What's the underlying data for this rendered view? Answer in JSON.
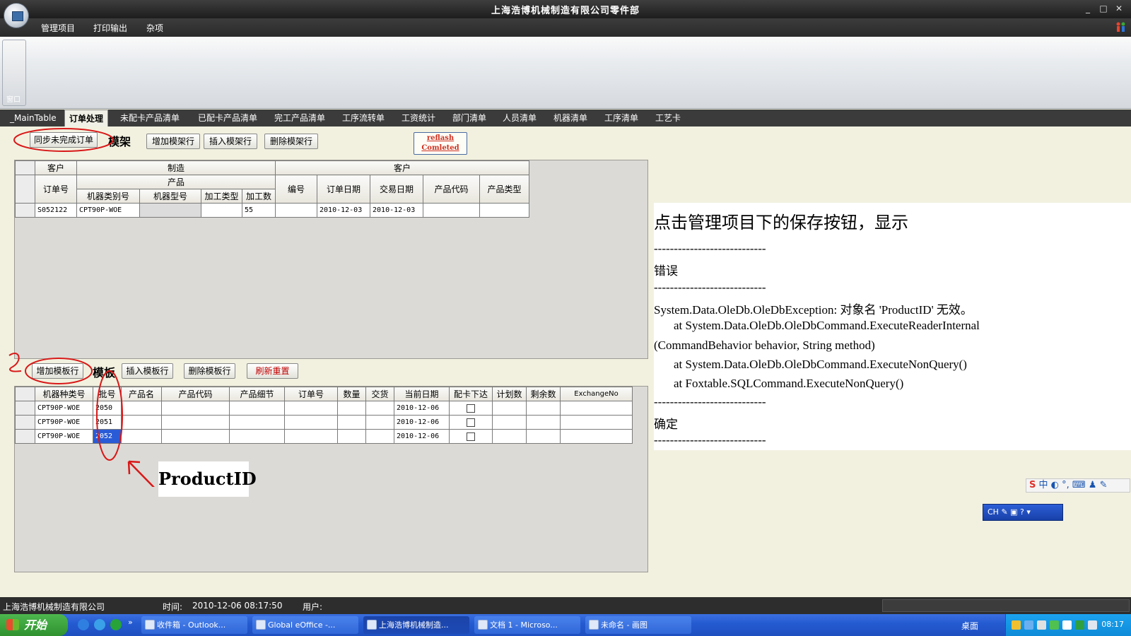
{
  "window": {
    "title": "上海浩博机械制造有限公司零件部",
    "controls": [
      "_",
      "□",
      "✕"
    ]
  },
  "menu": [
    "管理项目",
    "打印输出",
    "杂项"
  ],
  "ribbon": {
    "group_label": "窗口"
  },
  "tabs": [
    {
      "label": "_MainTable",
      "active": false
    },
    {
      "label": "订单处理",
      "active": true
    },
    {
      "label": "未配卡产品清单",
      "active": false
    },
    {
      "label": "已配卡产品清单",
      "active": false
    },
    {
      "label": "完工产品清单",
      "active": false
    },
    {
      "label": "工序流转单",
      "active": false
    },
    {
      "label": "工资统计",
      "active": false
    },
    {
      "label": "部门清单",
      "active": false
    },
    {
      "label": "人员清单",
      "active": false
    },
    {
      "label": "机器清单",
      "active": false
    },
    {
      "label": "工序清单",
      "active": false
    },
    {
      "label": "工艺卡",
      "active": false
    }
  ],
  "rack": {
    "sync_button": "同步未完成订单",
    "section_label": "模架",
    "add_row": "增加模架行",
    "insert_row": "插入模架行",
    "delete_row": "删除模架行",
    "reflash_line1": "reflash",
    "reflash_line2": "Comleted",
    "header_groups": {
      "customer_left": "客户",
      "manufacture": "制造",
      "customer_right": "客户",
      "product": "产品"
    },
    "columns": {
      "order_no": "订单号",
      "machine_category": "机器类别号",
      "machine_model": "机器型号",
      "process_type": "加工类型",
      "process_count": "加工数",
      "number": "编号",
      "order_date": "订单日期",
      "delivery_date": "交易日期",
      "product_code": "产品代码",
      "product_type": "产品类型"
    },
    "rows": [
      {
        "order_no": "S052122",
        "machine_category": "CPT90P-WOE",
        "machine_model": "",
        "process_type": "",
        "process_count": "55",
        "number": "",
        "order_date": "2010-12-03",
        "delivery_date": "2010-12-03",
        "product_code": "",
        "product_type": ""
      }
    ]
  },
  "template": {
    "section_label": "模板",
    "add_row": "增加模板行",
    "insert_row": "插入模板行",
    "delete_row": "删除模板行",
    "refresh_reset": "刷新重置",
    "columns": [
      "机器种类号",
      "批号",
      "产品名",
      "产品代码",
      "产品细节",
      "订单号",
      "数量",
      "交货",
      "当前日期",
      "配卡下达",
      "计划数",
      "剩余数",
      "ExchangeNo"
    ],
    "rows": [
      {
        "machine": "CPT90P-WOE",
        "batch": "2050",
        "date": "2010-12-06",
        "checked": false,
        "selected": false
      },
      {
        "machine": "CPT90P-WOE",
        "batch": "2051",
        "date": "2010-12-06",
        "checked": false,
        "selected": false
      },
      {
        "machine": "CPT90P-WOE",
        "batch": "2052",
        "date": "2010-12-06",
        "checked": false,
        "selected": true
      }
    ]
  },
  "annotations": {
    "mark1": "1",
    "mark2": "2",
    "productid_label": "ProductID"
  },
  "error_message": {
    "heading": "点击管理项目下的保存按钮，显示",
    "separator": "----------------------------",
    "title": "错误",
    "line1": "System.Data.OleDb.OleDbException:  对象名  'ProductID'  无效。",
    "line2": "at System.Data.OleDb.OleDbCommand.ExecuteReaderInternal",
    "line3": "(CommandBehavior behavior, String method)",
    "line4": "at System.Data.OleDb.OleDbCommand.ExecuteNonQuery()",
    "line5": "at Foxtable.SQLCommand.ExecuteNonQuery()",
    "ok": "确定"
  },
  "ime": {
    "toolbar": "中 ◐ °, ⌨ ♟ ✎",
    "langbar": "CH"
  },
  "statusbar": {
    "company": "上海浩博机械制造有限公司",
    "time_label": "时间:",
    "time_value": "2010-12-06 08:17:50",
    "user_label": "用户:"
  },
  "taskbar": {
    "start": "开始",
    "tasks": [
      {
        "label": "收件箱 - Outlook...",
        "active": false
      },
      {
        "label": "Global eOffice -...",
        "active": false
      },
      {
        "label": "上海浩博机械制造...",
        "active": true
      },
      {
        "label": "文档 1 - Microso...",
        "active": false
      },
      {
        "label": "未命名 - 画图",
        "active": false
      }
    ],
    "desktop": "桌面",
    "clock": "08:17"
  },
  "colors": {
    "annotation_red": "#d81818",
    "selection_blue": "#2a5bd7"
  }
}
